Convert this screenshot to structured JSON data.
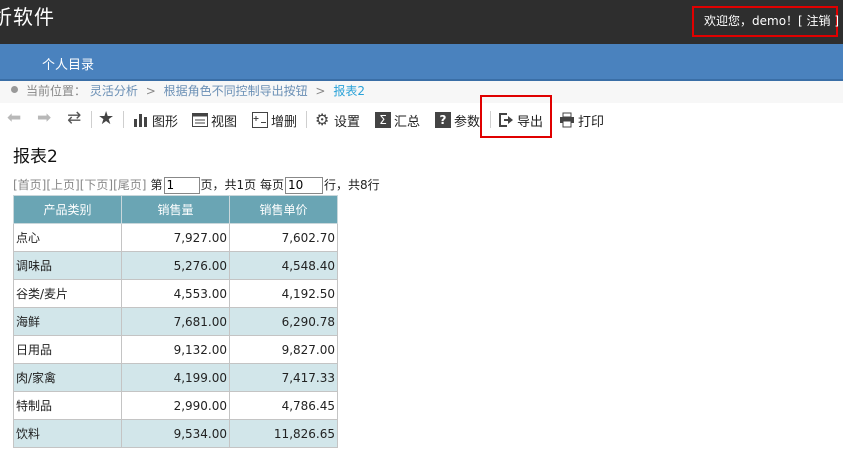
{
  "header": {
    "app_title": "析软件",
    "welcome": "欢迎您，demo！[ 注销 ]"
  },
  "nav": {
    "items": [
      {
        "label": "个人目录"
      }
    ]
  },
  "breadcrumb": {
    "prefix": "当前位置：",
    "items": [
      "灵活分析",
      "根据角色不同控制导出按钮",
      "报表2"
    ],
    "separator": ">"
  },
  "toolbar": {
    "back_icon": "back-arrow",
    "forward_icon": "forward-arrow",
    "refresh_icon": "refresh",
    "favorite_icon": "star",
    "chart_label": "图形",
    "view_label": "视图",
    "addremove_label": "增删",
    "settings_label": "设置",
    "summary_label": "汇总",
    "params_label": "参数",
    "export_label": "导出",
    "print_label": "打印"
  },
  "report": {
    "title": "报表2",
    "pager": {
      "first": "[首页]",
      "prev": "[上页]",
      "next": "[下页]",
      "last": "[尾页]",
      "page_prefix": "第",
      "page_value": "1",
      "page_total_text": "页，共1页 每页",
      "per_page_value": "10",
      "rows_text": "行，共8行"
    },
    "columns": [
      "产品类别",
      "销售量",
      "销售单价"
    ],
    "rows": [
      [
        "点心",
        "7,927.00",
        "7,602.70"
      ],
      [
        "调味品",
        "5,276.00",
        "4,548.40"
      ],
      [
        "谷类/麦片",
        "4,553.00",
        "4,192.50"
      ],
      [
        "海鲜",
        "7,681.00",
        "6,290.78"
      ],
      [
        "日用品",
        "9,132.00",
        "9,827.00"
      ],
      [
        "肉/家禽",
        "4,199.00",
        "7,417.33"
      ],
      [
        "特制品",
        "2,990.00",
        "4,786.45"
      ],
      [
        "饮料",
        "9,534.00",
        "11,826.65"
      ]
    ]
  },
  "colors": {
    "topbar": "#2e2e2e",
    "navbar": "#4a82be",
    "highlight": "#e00000",
    "table_header": "#6aa5b4",
    "table_alt_row": "#d2e6ea"
  }
}
